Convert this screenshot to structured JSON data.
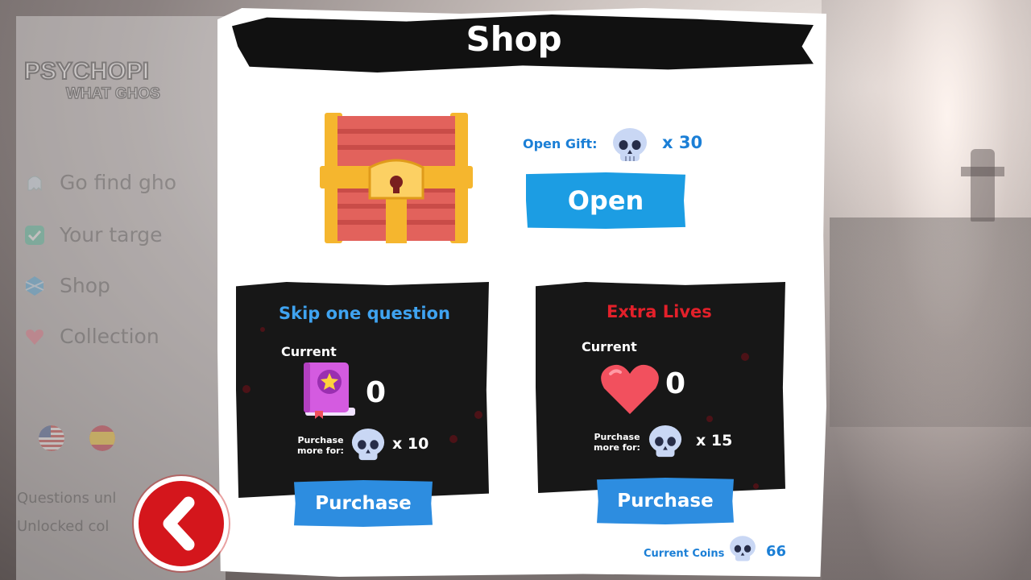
{
  "title": "Shop",
  "sidebar": {
    "logo_main": "PSYCHOPI",
    "logo_sub": "WHAT GHOS",
    "items": [
      {
        "label": "Go find gho",
        "icon": "ghost-icon"
      },
      {
        "label": "Your targe",
        "icon": "checkbox-icon"
      },
      {
        "label": "Shop",
        "icon": "gem-icon"
      },
      {
        "label": "Collection",
        "icon": "heart-icon"
      }
    ],
    "flags": [
      "usa-flag-icon",
      "spain-flag-icon"
    ],
    "footer_lines": [
      "Questions unl",
      "Unlocked col"
    ]
  },
  "gift": {
    "label": "Open Gift:",
    "cost": "x 30",
    "button_label": "Open"
  },
  "cards": [
    {
      "title": "Skip one question",
      "title_color": "#3fa3f0",
      "current_label": "Current",
      "current_value": "0",
      "purchase_label": "Purchase more for:",
      "cost": "x 10",
      "button_label": "Purchase",
      "icon": "book-icon"
    },
    {
      "title": "Extra Lives",
      "title_color": "#e3202a",
      "current_label": "Current",
      "current_value": "0",
      "purchase_label": "Purchase more for:",
      "cost": "x 15",
      "button_label": "Purchase",
      "icon": "heart-icon"
    }
  ],
  "coins": {
    "label": "Current Coins",
    "value": "66"
  },
  "colors": {
    "accent_blue": "#1c9de3",
    "button_blue": "#2d8de0",
    "danger_red": "#d4161c"
  }
}
